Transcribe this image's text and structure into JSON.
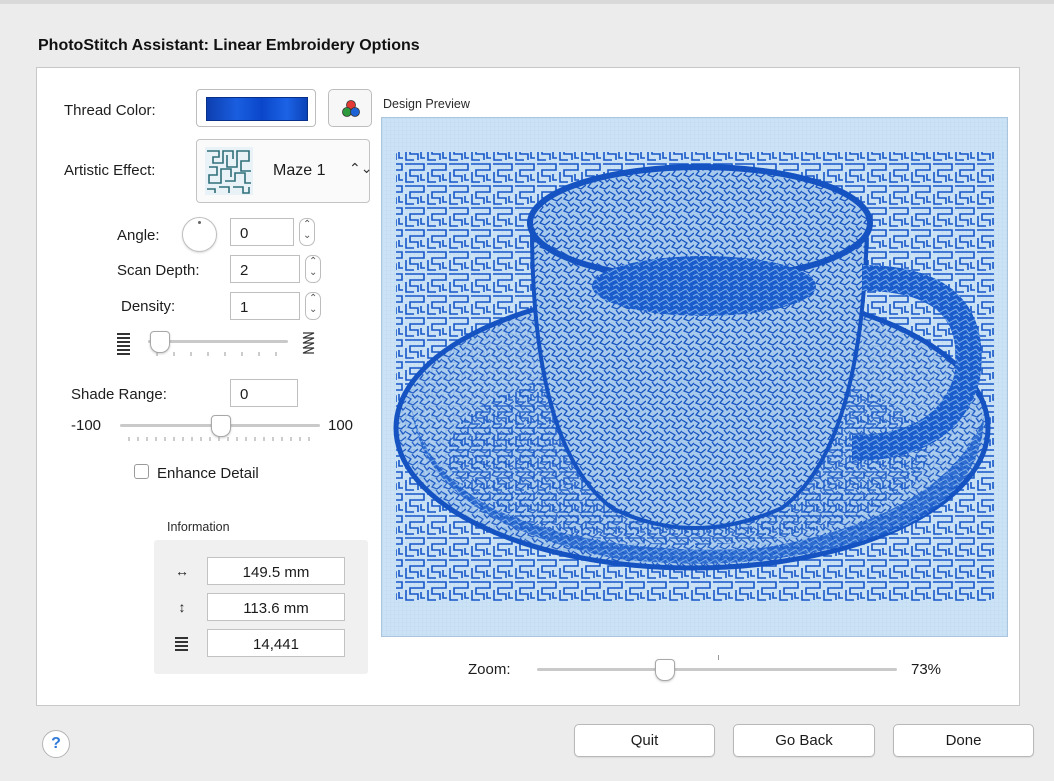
{
  "dialog": {
    "title": "PhotoStitch Assistant: Linear Embroidery Options"
  },
  "thread": {
    "label": "Thread Color:",
    "color": "#1450d4"
  },
  "effect": {
    "label": "Artistic Effect:",
    "value": "Maze 1"
  },
  "angle": {
    "label": "Angle:",
    "value": "0"
  },
  "scan_depth": {
    "label": "Scan Depth:",
    "value": "2"
  },
  "density": {
    "label": "Density:",
    "value": "1"
  },
  "shade_range": {
    "label": "Shade Range:",
    "value": "0",
    "min": "-100",
    "max": "100"
  },
  "enhance_detail": {
    "label": "Enhance Detail",
    "checked": false
  },
  "information": {
    "title": "Information",
    "width": "149.5 mm",
    "height": "113.6 mm",
    "stitches": "14,441"
  },
  "preview": {
    "title": "Design Preview",
    "stitch_color": "#1250c4",
    "background": "#c9e1f5"
  },
  "zoom": {
    "label": "Zoom:",
    "value": "73%"
  },
  "buttons": {
    "help": "?",
    "quit": "Quit",
    "go_back": "Go Back",
    "done": "Done"
  }
}
